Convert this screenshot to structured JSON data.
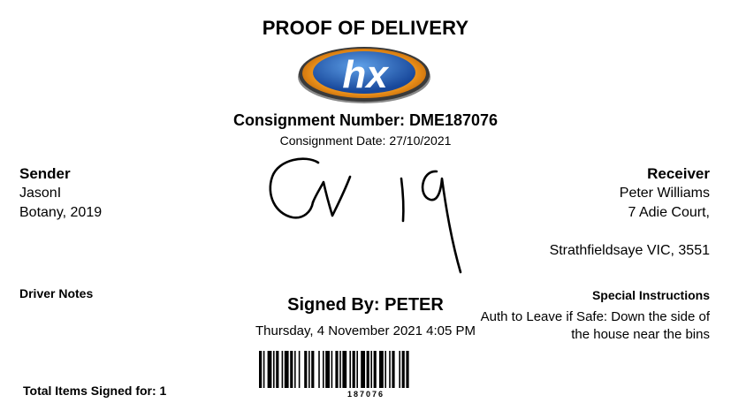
{
  "document": {
    "title": "PROOF OF DELIVERY",
    "logo_text": "hx",
    "consignment_number": "Consignment Number: DME187076",
    "consignment_date": "Consignment Date: 27/10/2021"
  },
  "sender": {
    "heading": "Sender",
    "name": "JasonI",
    "address": "Botany, 2019"
  },
  "receiver": {
    "heading": "Receiver",
    "name": "Peter Williams",
    "address_line1": "7 Adie Court,",
    "address_line2": "Strathfieldsaye VIC, 3551"
  },
  "driver_notes": {
    "heading": "Driver Notes"
  },
  "signature": {
    "signed_by": "Signed By: PETER",
    "signed_date": "Thursday, 4 November 2021 4:05 PM"
  },
  "special_instructions": {
    "heading": "Special Instructions",
    "text": "Auth to Leave if Safe: Down the side of the house near the bins"
  },
  "footer": {
    "total_items": "Total Items Signed for: 1",
    "barcode_number": "187076"
  },
  "colors": {
    "logo_blue": "#1d5fae",
    "logo_orange": "#f39a1f"
  }
}
